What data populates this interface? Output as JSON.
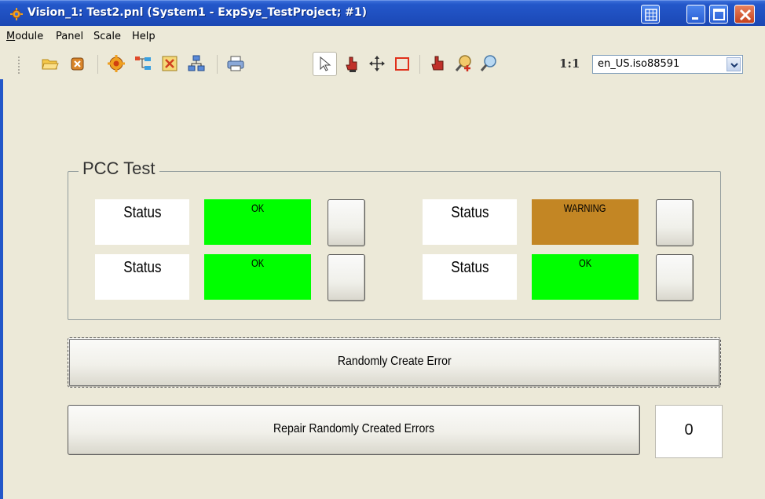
{
  "window": {
    "title": "Vision_1: Test2.pnl (System1 - ExpSys_TestProject; #1)",
    "icons": [
      "app-gear-icon",
      "grid-icon",
      "minimize-icon",
      "maximize-icon",
      "close-icon"
    ]
  },
  "menu": {
    "items": [
      {
        "label_first": "M",
        "label_rest": "odule"
      },
      {
        "label": "Panel"
      },
      {
        "label": "Scale"
      },
      {
        "label": "Help"
      }
    ]
  },
  "toolbar": {
    "tools": [
      "open-folder-icon",
      "close-panel-icon",
      "settings-gear-icon",
      "tree-view-icon",
      "panel-config-icon",
      "network-icon",
      "print-icon",
      "select-arrow-icon",
      "hand-cursor-icon",
      "move-icon",
      "rectangle-icon",
      "zoom-cursor-icon",
      "zoom-in-icon",
      "zoom-out-icon"
    ],
    "scale_label": "1:1",
    "locale": "en_US.iso88591"
  },
  "group": {
    "title": "PCC Test",
    "rows": [
      {
        "label": "Status",
        "value": "OK",
        "color": "#00ff00"
      },
      {
        "label": "Status",
        "value": "OK",
        "color": "#00ff00"
      },
      {
        "label": "Status",
        "value": "WARNING",
        "color": "#c38624"
      },
      {
        "label": "Status",
        "value": "OK",
        "color": "#00ff00"
      }
    ]
  },
  "actions": {
    "create_error": "Randomly Create Error",
    "repair_errors": "Repair Randomly Created Errors",
    "counter": "0"
  }
}
